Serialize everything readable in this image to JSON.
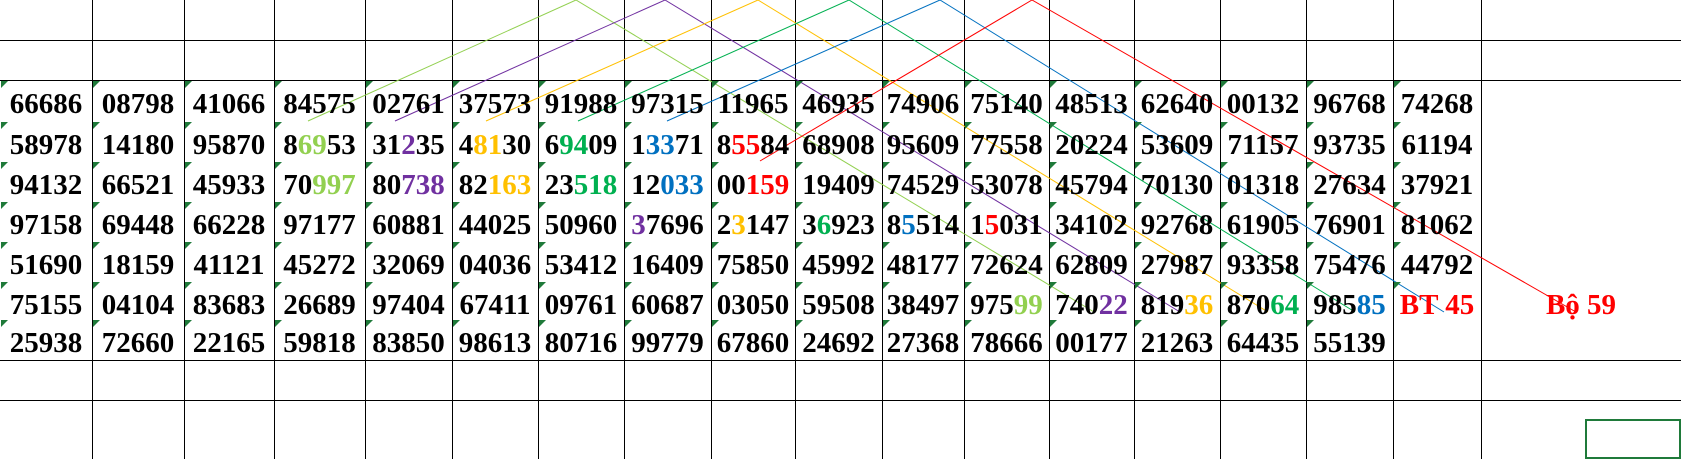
{
  "colors": {
    "c1": "#92d050",
    "c2": "#7030a0",
    "c3": "#ffc000",
    "c4": "#00b050",
    "c5": "#0070c0",
    "c6": "#ff0000"
  },
  "rows": [
    [
      [
        {
          "t": "66686"
        }
      ],
      [
        {
          "t": "08798"
        }
      ],
      [
        {
          "t": "41066"
        }
      ],
      [
        {
          "t": "84575"
        }
      ],
      [
        {
          "t": "02761"
        }
      ],
      [
        {
          "t": "37573"
        }
      ],
      [
        {
          "t": "91988"
        }
      ],
      [
        {
          "t": "97315"
        }
      ],
      [
        {
          "t": "11965"
        }
      ],
      [
        {
          "t": "46935"
        }
      ],
      [
        {
          "t": "74906"
        }
      ],
      [
        {
          "t": "75140"
        }
      ],
      [
        {
          "t": "48513"
        }
      ],
      [
        {
          "t": "62640"
        }
      ],
      [
        {
          "t": "00132"
        }
      ],
      [
        {
          "t": "96768"
        }
      ],
      [
        {
          "t": "74268"
        }
      ],
      [
        {
          "t": ""
        }
      ]
    ],
    [
      [
        {
          "t": "58978"
        }
      ],
      [
        {
          "t": "14180"
        }
      ],
      [
        {
          "t": "95870"
        }
      ],
      [
        {
          "t": "8"
        },
        {
          "t": "69",
          "c": "#92d050"
        },
        {
          "t": "53"
        }
      ],
      [
        {
          "t": "31"
        },
        {
          "t": "2",
          "c": "#7030a0"
        },
        {
          "t": "35"
        }
      ],
      [
        {
          "t": "4"
        },
        {
          "t": "81",
          "c": "#ffc000"
        },
        {
          "t": "30"
        }
      ],
      [
        {
          "t": "6"
        },
        {
          "t": "94",
          "c": "#00b050"
        },
        {
          "t": "09"
        }
      ],
      [
        {
          "t": "1"
        },
        {
          "t": "33",
          "c": "#0070c0"
        },
        {
          "t": "71"
        }
      ],
      [
        {
          "t": "8"
        },
        {
          "t": "55",
          "c": "#ff0000"
        },
        {
          "t": "84"
        }
      ],
      [
        {
          "t": "68908"
        }
      ],
      [
        {
          "t": "95609"
        }
      ],
      [
        {
          "t": "77558"
        }
      ],
      [
        {
          "t": "20224"
        }
      ],
      [
        {
          "t": "53609"
        }
      ],
      [
        {
          "t": "71157"
        }
      ],
      [
        {
          "t": "93735"
        }
      ],
      [
        {
          "t": "61194"
        }
      ],
      [
        {
          "t": ""
        }
      ]
    ],
    [
      [
        {
          "t": "94132"
        }
      ],
      [
        {
          "t": "66521"
        }
      ],
      [
        {
          "t": "45933"
        }
      ],
      [
        {
          "t": "70"
        },
        {
          "t": "997",
          "c": "#92d050"
        }
      ],
      [
        {
          "t": "80"
        },
        {
          "t": "738",
          "c": "#7030a0"
        }
      ],
      [
        {
          "t": "82"
        },
        {
          "t": "163",
          "c": "#ffc000"
        }
      ],
      [
        {
          "t": "23"
        },
        {
          "t": "518",
          "c": "#00b050"
        }
      ],
      [
        {
          "t": "12"
        },
        {
          "t": "033",
          "c": "#0070c0"
        }
      ],
      [
        {
          "t": "00"
        },
        {
          "t": "159",
          "c": "#ff0000"
        }
      ],
      [
        {
          "t": "19409"
        }
      ],
      [
        {
          "t": "74529"
        }
      ],
      [
        {
          "t": "53078"
        }
      ],
      [
        {
          "t": "45794"
        }
      ],
      [
        {
          "t": "70130"
        }
      ],
      [
        {
          "t": "01318"
        }
      ],
      [
        {
          "t": "27634"
        }
      ],
      [
        {
          "t": "37921"
        }
      ],
      [
        {
          "t": ""
        }
      ]
    ],
    [
      [
        {
          "t": "97158"
        }
      ],
      [
        {
          "t": "69448"
        }
      ],
      [
        {
          "t": "66228"
        }
      ],
      [
        {
          "t": "97177"
        }
      ],
      [
        {
          "t": "60881"
        }
      ],
      [
        {
          "t": "44025"
        }
      ],
      [
        {
          "t": "50960"
        }
      ],
      [
        {
          "t": "3",
          "c": "#7030a0"
        },
        {
          "t": "7696"
        }
      ],
      [
        {
          "t": "2"
        },
        {
          "t": "3",
          "c": "#ffc000"
        },
        {
          "t": "147"
        }
      ],
      [
        {
          "t": "3"
        },
        {
          "t": "6",
          "c": "#00b050"
        },
        {
          "t": "923"
        }
      ],
      [
        {
          "t": "8"
        },
        {
          "t": "5",
          "c": "#0070c0"
        },
        {
          "t": "514"
        }
      ],
      [
        {
          "t": "1"
        },
        {
          "t": "5",
          "c": "#ff0000"
        },
        {
          "t": "031"
        }
      ],
      [
        {
          "t": "34102"
        }
      ],
      [
        {
          "t": "92768"
        }
      ],
      [
        {
          "t": "61905"
        }
      ],
      [
        {
          "t": "76901"
        }
      ],
      [
        {
          "t": "81062"
        }
      ],
      [
        {
          "t": ""
        }
      ]
    ],
    [
      [
        {
          "t": "51690"
        }
      ],
      [
        {
          "t": "18159"
        }
      ],
      [
        {
          "t": "41121"
        }
      ],
      [
        {
          "t": "45272"
        }
      ],
      [
        {
          "t": "32069"
        }
      ],
      [
        {
          "t": "04036"
        }
      ],
      [
        {
          "t": "53412"
        }
      ],
      [
        {
          "t": "16409"
        }
      ],
      [
        {
          "t": "75850"
        }
      ],
      [
        {
          "t": "45992"
        }
      ],
      [
        {
          "t": "48177"
        }
      ],
      [
        {
          "t": "72624"
        }
      ],
      [
        {
          "t": "62809"
        }
      ],
      [
        {
          "t": "27987"
        }
      ],
      [
        {
          "t": "93358"
        }
      ],
      [
        {
          "t": "75476"
        }
      ],
      [
        {
          "t": "44792"
        }
      ],
      [
        {
          "t": ""
        }
      ]
    ],
    [
      [
        {
          "t": "75155"
        }
      ],
      [
        {
          "t": "04104"
        }
      ],
      [
        {
          "t": "83683"
        }
      ],
      [
        {
          "t": "26689"
        }
      ],
      [
        {
          "t": "97404"
        }
      ],
      [
        {
          "t": "67411"
        }
      ],
      [
        {
          "t": "09761"
        }
      ],
      [
        {
          "t": "60687"
        }
      ],
      [
        {
          "t": "03050"
        }
      ],
      [
        {
          "t": "59508"
        }
      ],
      [
        {
          "t": "38497"
        }
      ],
      [
        {
          "t": "975"
        },
        {
          "t": "99",
          "c": "#92d050"
        }
      ],
      [
        {
          "t": "740"
        },
        {
          "t": "22",
          "c": "#7030a0"
        }
      ],
      [
        {
          "t": "819"
        },
        {
          "t": "36",
          "c": "#ffc000"
        }
      ],
      [
        {
          "t": "870"
        },
        {
          "t": "64",
          "c": "#00b050"
        }
      ],
      [
        {
          "t": "985"
        },
        {
          "t": "85",
          "c": "#0070c0"
        }
      ],
      [
        {
          "t": "BT 45",
          "c": "#ff0000"
        }
      ],
      [
        {
          "t": "Bộ 59",
          "c": "#ff0000"
        }
      ]
    ],
    [
      [
        {
          "t": "25938"
        }
      ],
      [
        {
          "t": "72660"
        }
      ],
      [
        {
          "t": "22165"
        }
      ],
      [
        {
          "t": "59818"
        }
      ],
      [
        {
          "t": "83850"
        }
      ],
      [
        {
          "t": "98613"
        }
      ],
      [
        {
          "t": "80716"
        }
      ],
      [
        {
          "t": "99779"
        }
      ],
      [
        {
          "t": "67860"
        }
      ],
      [
        {
          "t": "24692"
        }
      ],
      [
        {
          "t": "27368"
        }
      ],
      [
        {
          "t": "78666"
        }
      ],
      [
        {
          "t": "00177"
        }
      ],
      [
        {
          "t": "21263"
        }
      ],
      [
        {
          "t": "64435"
        }
      ],
      [
        {
          "t": "55139"
        }
      ],
      [
        {
          "t": ""
        }
      ],
      [
        {
          "t": ""
        }
      ]
    ]
  ]
}
